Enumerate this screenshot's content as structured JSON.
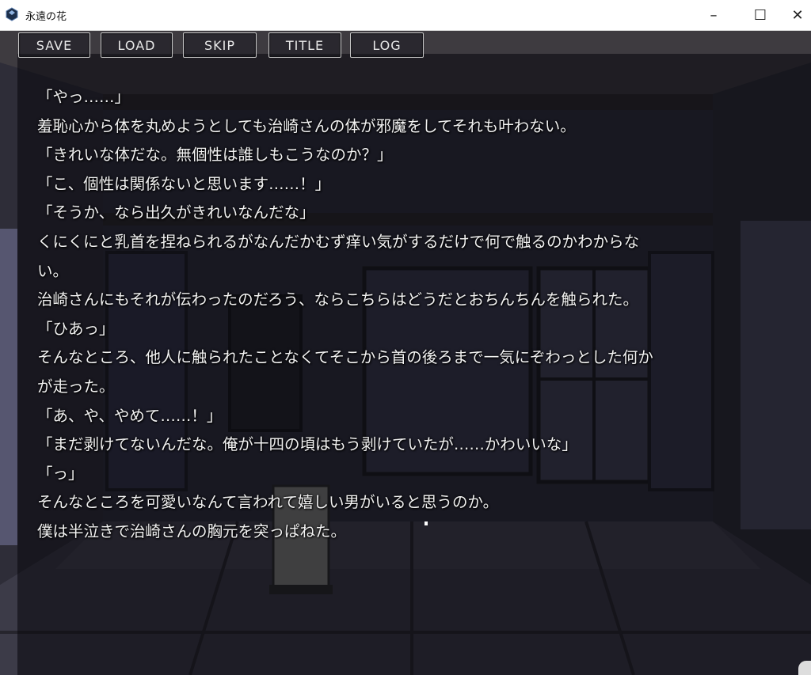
{
  "window": {
    "title": "永遠の花",
    "minimize": "–",
    "maximize": "☐",
    "close": "✕"
  },
  "menu": {
    "save": "SAVE",
    "load": "LOAD",
    "skip": "SKIP",
    "title": "TITLE",
    "log": "LOG"
  },
  "dialogue": [
    "「やっ……」",
    "羞恥心から体を丸めようとしても治崎さんの体が邪魔をしてそれも叶わない。",
    "「きれいな体だな。無個性は誰しもこうなのか？」",
    "「こ、個性は関係ないと思います……！」",
    "「そうか、なら出久がきれいなんだな」",
    "くにくにと乳首を捏ねられるがなんだかむず痒い気がするだけで何で触るのかわからな",
    "い。",
    "治崎さんにもそれが伝わったのだろう、ならこちらはどうだとおちんちんを触られた。",
    "「ひあっ」",
    "そんなところ、他人に触られたことなくてそこから首の後ろまで一気にぞわっとした何か",
    "が走った。",
    "「あ、や、やめて……！」",
    "「まだ剥けてないんだな。俺が十四の頃はもう剥けていたが……かわいいな」",
    "「っ」",
    "そんなところを可愛いなんて言われて嬉しい男がいると思うのか。",
    "僕は半泣きで治崎さんの胸元を突っぱねた。"
  ],
  "colors": {
    "text": "#f2f2f2",
    "overlay": "rgba(8,8,14,0.58)",
    "button_border": "#c6c6c6"
  }
}
